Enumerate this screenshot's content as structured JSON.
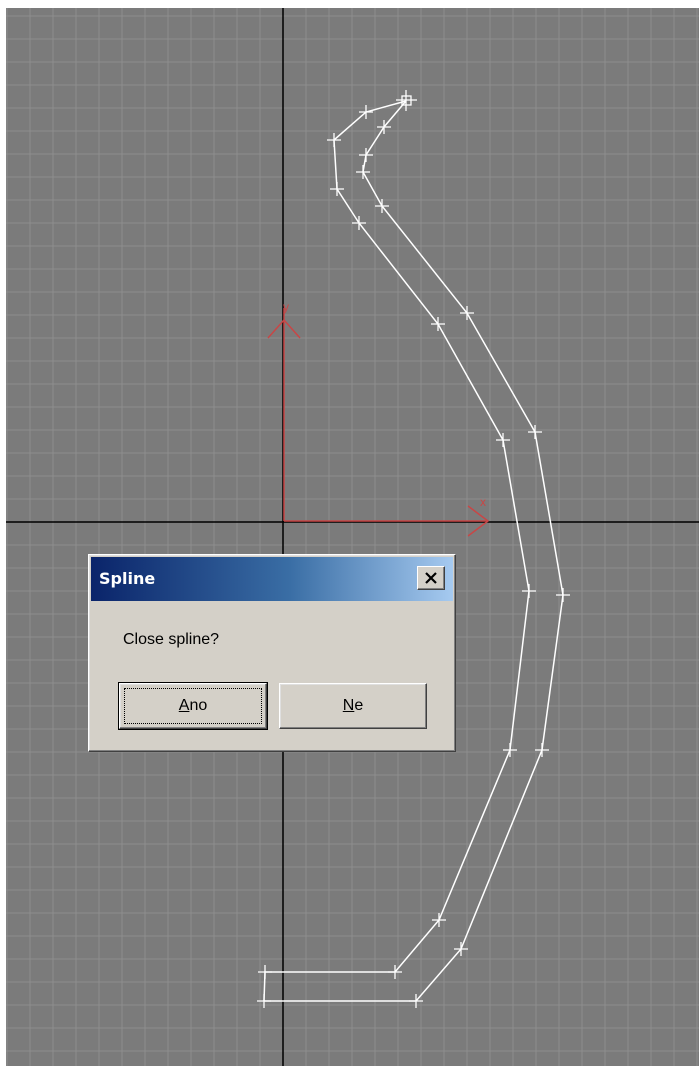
{
  "colors": {
    "viewport_bg": "#7b7b7b",
    "grid_line": "#8e8e8e",
    "axis_line": "#000000",
    "gizmo": "#c84646",
    "spline": "#ffffff"
  },
  "viewport": {
    "gizmo_labels": {
      "y": "y",
      "x": "x"
    }
  },
  "dialog": {
    "title": "Spline",
    "message": "Close spline?",
    "yes_mnemonic": "A",
    "yes_rest": "no",
    "no_mnemonic": "N",
    "no_rest": "e",
    "close_icon": "close-icon"
  }
}
